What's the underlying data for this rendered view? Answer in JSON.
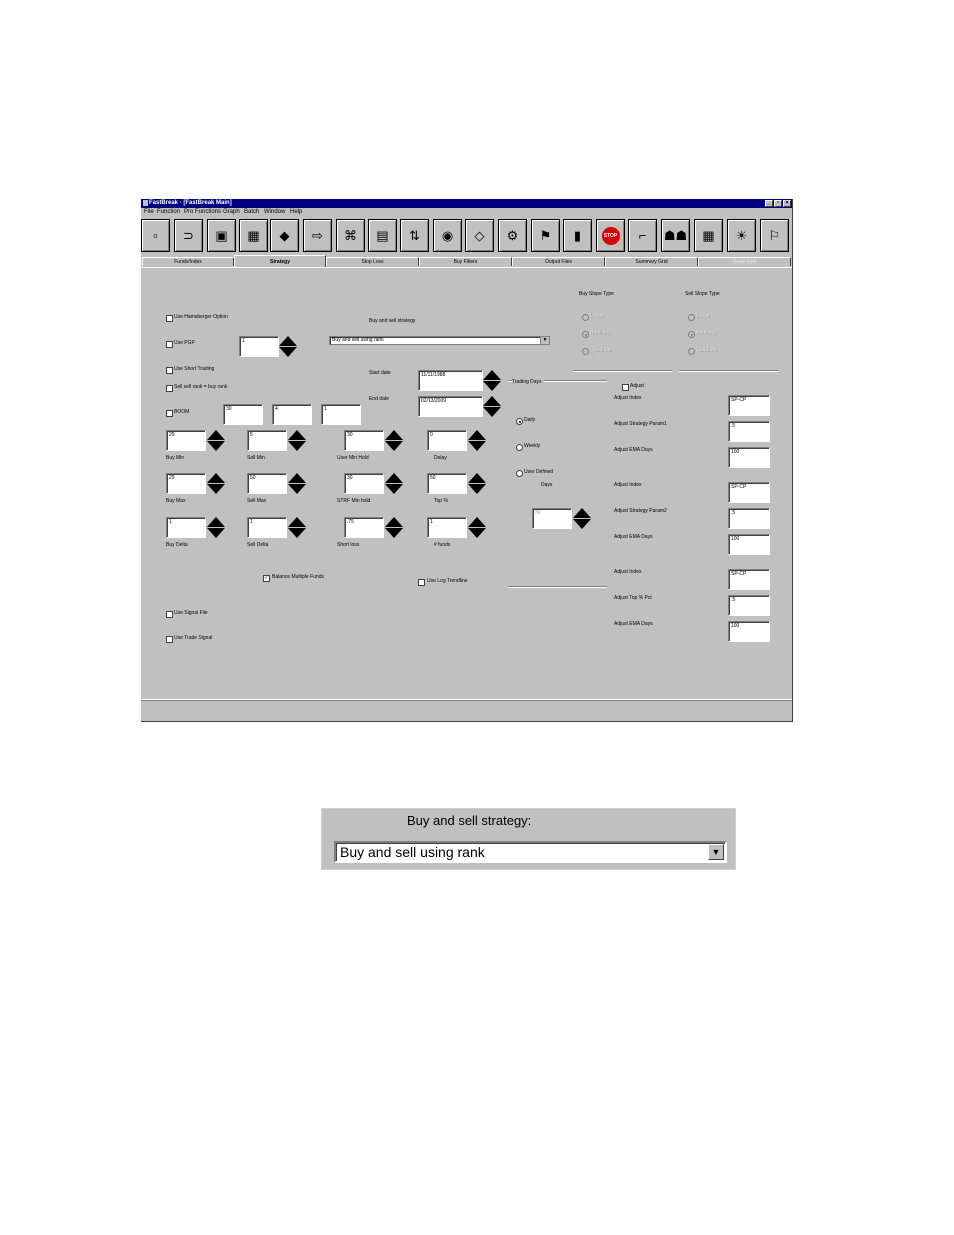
{
  "window": {
    "title": "FastBreak - [FastBreak Main]",
    "controls": [
      "_",
      "▫",
      "×"
    ]
  },
  "menu": [
    "File",
    "Function",
    "Pro Functions",
    "Graph",
    "Batch",
    "Window",
    "Help"
  ],
  "toolbar": [
    {
      "icon": "new-icon",
      "glyph": "▫"
    },
    {
      "icon": "open-icon",
      "glyph": "⊃"
    },
    {
      "icon": "save-icon",
      "glyph": "▣"
    },
    {
      "icon": "image-icon",
      "glyph": "▦"
    },
    {
      "icon": "eraser-icon",
      "glyph": "◆"
    },
    {
      "icon": "export-icon",
      "glyph": "⇨"
    },
    {
      "icon": "network-icon",
      "glyph": "⌘"
    },
    {
      "icon": "book-icon",
      "glyph": "▤"
    },
    {
      "icon": "sort-icon",
      "glyph": "⇅"
    },
    {
      "icon": "color-wheel-icon",
      "glyph": "◉"
    },
    {
      "icon": "diamond-icon",
      "glyph": "◇"
    },
    {
      "icon": "gear-icon",
      "glyph": "⚙"
    },
    {
      "icon": "flag-icon",
      "glyph": "⚑"
    },
    {
      "icon": "bar-chart-icon",
      "glyph": "▮"
    },
    {
      "icon": "stop-icon",
      "glyph": "STOP"
    },
    {
      "icon": "faucet-icon",
      "glyph": "⌐"
    },
    {
      "icon": "people-icon",
      "glyph": "☗☗"
    },
    {
      "icon": "grid-icon",
      "glyph": "▦"
    },
    {
      "icon": "bulb-icon",
      "glyph": "☀"
    },
    {
      "icon": "exit-icon",
      "glyph": "⚐"
    }
  ],
  "tabs": [
    {
      "label": "Funds/Index",
      "state": "normal"
    },
    {
      "label": "Strategy",
      "state": "active"
    },
    {
      "label": "Stop Loss",
      "state": "normal"
    },
    {
      "label": "Buy Filters",
      "state": "normal"
    },
    {
      "label": "Output Files",
      "state": "normal"
    },
    {
      "label": "Summary Grid",
      "state": "normal"
    },
    {
      "label": "Detail Grid",
      "state": "disabled"
    }
  ],
  "options": {
    "hamsberger": {
      "label": "Use Hamsberger Option",
      "checked": false
    },
    "pgp": {
      "label": "Use PGP",
      "checked": false,
      "value": "1"
    },
    "short_trading": {
      "label": "Use Short Trading",
      "checked": false
    },
    "sell_rank": {
      "label": "Sell sell rank = buy rank",
      "checked": false
    },
    "boom": {
      "label": "BOOM",
      "checked": false,
      "values": [
        "30",
        "4",
        "1"
      ]
    }
  },
  "strategy": {
    "label": "Buy and sell strategy:",
    "label_small": "Buy and sell strategy",
    "value": "Buy and sell using rank"
  },
  "dates": {
    "start_label": "Start date",
    "start": "11/11/1988",
    "end_label": "End date",
    "end": "02/13/2009"
  },
  "params": [
    {
      "label": "Buy Min",
      "value": "29"
    },
    {
      "label": "Sell Min",
      "value": "5"
    },
    {
      "label": "User Min Hold",
      "value": "30"
    },
    {
      "label": "Delay",
      "value": "0"
    },
    {
      "label": "Buy Max",
      "value": "29"
    },
    {
      "label": "Sell Max",
      "value": "50"
    },
    {
      "label": "STRF Min hold",
      "value": "30"
    },
    {
      "label": "Top %",
      "value": "50"
    },
    {
      "label": "Buy Delta",
      "value": "1"
    },
    {
      "label": "Sell Delta",
      "value": "1"
    },
    {
      "label": "Short loss",
      "value": ".75"
    },
    {
      "label": "# funds",
      "value": "1"
    }
  ],
  "balance": {
    "label": "Balance Multiple Funds",
    "checked": true
  },
  "log_trendline": {
    "label": "Use Log Trendline",
    "checked": false
  },
  "signal_file": {
    "label": "Use Signal File",
    "checked": false
  },
  "trade_signal": {
    "label": "Use Trade Signal",
    "checked": false
  },
  "trading_days": {
    "label": "Trading Days",
    "options": [
      {
        "label": "Daily",
        "selected": true
      },
      {
        "label": "Weekly",
        "selected": false
      },
      {
        "label": "User Defined",
        "selected": false
      }
    ],
    "days_label": "Days",
    "days_value": "30"
  },
  "buy_slope": {
    "label": "Buy Slope Type",
    "options": [
      "Linear",
      "Nonlinear",
      "Quadratic"
    ],
    "selected": 1
  },
  "sell_slope": {
    "label": "Sell Slope Type",
    "options": [
      "Linear",
      "Nonlinear",
      "Quadratic"
    ],
    "selected": 1
  },
  "adjust": {
    "checkbox_label": "Adjust",
    "rows": [
      {
        "label": "Adjust Index",
        "value": "SP-CP"
      },
      {
        "label": "Adjust Strategy Param1",
        "value": ".5"
      },
      {
        "label": "Adjust EMA Days",
        "value": "100"
      },
      {
        "label": "Adjust Index",
        "value": "SP-CP"
      },
      {
        "label": "Adjust Strategy Param2",
        "value": ".5"
      },
      {
        "label": "Adjust EMA Days",
        "value": "100"
      },
      {
        "label": "Adjust Index",
        "value": "SP-CP"
      },
      {
        "label": "Adjust Top % Pct",
        "value": ".5"
      },
      {
        "label": "Adjust EMA Days",
        "value": "100"
      }
    ]
  }
}
